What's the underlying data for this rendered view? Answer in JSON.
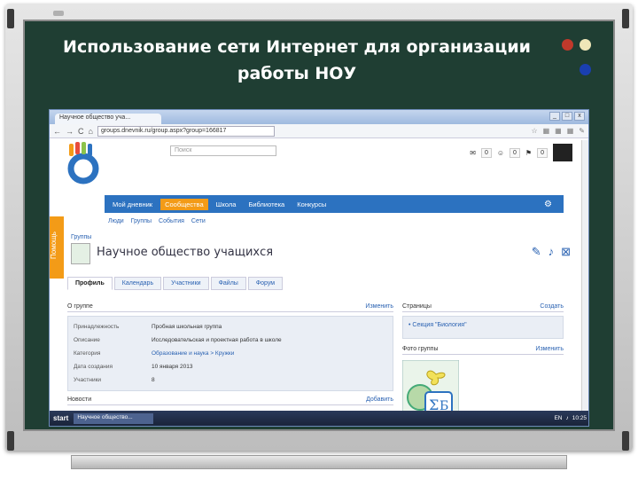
{
  "slide": {
    "title_line1": "Использование сети Интернет для организации",
    "title_line2": "работы НОУ",
    "colors": {
      "board": "#1f3e33",
      "frame": "#c9c9c9",
      "dot_red": "#c0392b",
      "dot_cream": "#efe6b8",
      "dot_blue": "#1a3fb0"
    }
  },
  "browser": {
    "tab_title": "Научное общество уча...",
    "url": "groups.dnevnik.ru/group.aspx?group=166817",
    "nav": {
      "back": "←",
      "forward": "→",
      "reload": "C",
      "home": "⌂"
    },
    "window_buttons": [
      "_",
      "□",
      "x"
    ]
  },
  "site": {
    "search_placeholder": "Поиск",
    "counters": [
      "0",
      "0",
      "0"
    ],
    "main_nav": [
      "Мой дневник",
      "Сообщества",
      "Школа",
      "Библиотека",
      "Конкурсы"
    ],
    "main_nav_active": 1,
    "sub_nav": [
      "Люди",
      "Группы",
      "События",
      "Сети"
    ],
    "help_label": "Помощь",
    "group_label": "Группы",
    "group_name": "Научное общество учащихся",
    "tabs": [
      "Профиль",
      "Календарь",
      "Участники",
      "Файлы",
      "Форум"
    ],
    "active_tab": 0,
    "about": {
      "title": "О группе",
      "action": "Изменить",
      "rows": [
        {
          "k": "Принадлежность",
          "v": "Пробная школьная группа"
        },
        {
          "k": "Описание",
          "v": "Исследовательская и проектная работа в школе"
        },
        {
          "k": "Категория",
          "v": "Образование и наука > Кружки"
        },
        {
          "k": "Дата создания",
          "v": "10 января 2013"
        },
        {
          "k": "Участники",
          "v": "8"
        }
      ]
    },
    "news": {
      "title": "Новости",
      "action": "Добавить"
    },
    "pages": {
      "title": "Страницы",
      "action": "Создать",
      "item": "• Секция \"Биология\""
    },
    "photo": {
      "title": "Фото группы",
      "action": "Изменить"
    }
  },
  "taskbar": {
    "start": "start",
    "task": "Научное общество...",
    "lang": "EN",
    "time": "10:25"
  }
}
